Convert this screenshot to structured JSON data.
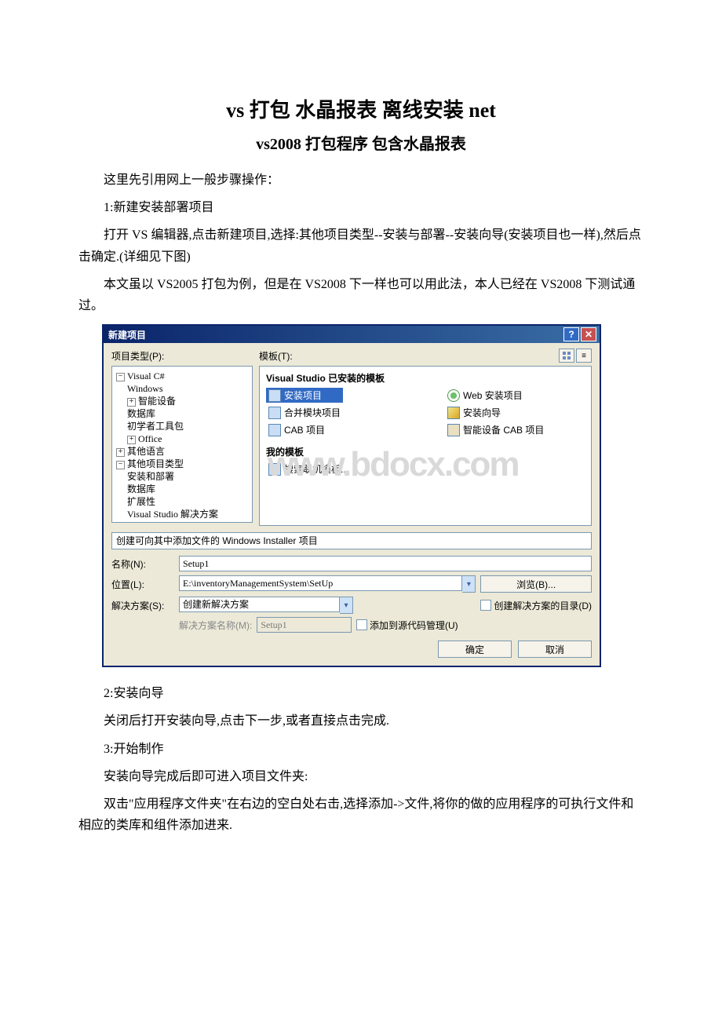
{
  "title": "vs 打包 水晶报表 离线安装 net",
  "subtitle": "vs2008 打包程序 包含水晶报表",
  "paragraphs": {
    "p1": "这里先引用网上一般步骤操作：",
    "p2": "1:新建安装部署项目",
    "p3": "打开 VS 编辑器,点击新建项目,选择:其他项目类型--安装与部署--安装向导(安装项目也一样),然后点击确定.(详细见下图)",
    "p4": "本文虽以 VS2005 打包为例，但是在 VS2008 下一样也可以用此法，本人已经在 VS2008 下测试通过。",
    "p5": "2:安装向导",
    "p6": "关闭后打开安装向导,点击下一步,或者直接点击完成.",
    "p7": "3:开始制作",
    "p8": "安装向导完成后即可进入项目文件夹:",
    "p9": "双击\"应用程序文件夹\"在右边的空白处右击,选择添加->文件,将你的做的应用程序的可执行文件和相应的类库和组件添加进来."
  },
  "dialog": {
    "title": "新建项目",
    "help": "?",
    "close": "✕",
    "proj_types_label": "项目类型(P):",
    "templates_label": "模板(T):",
    "tree": {
      "n0": "Visual C#",
      "n0_0": "Windows",
      "n0_1": "智能设备",
      "n0_2": "数据库",
      "n0_3": "初学者工具包",
      "n0_4": "Office",
      "n1": "其他语言",
      "n2": "其他项目类型",
      "n2_0": "安装和部署",
      "n2_1": "数据库",
      "n2_2": "扩展性",
      "n2_3": "Visual Studio 解决方案"
    },
    "section_installed": "Visual Studio 已安装的模板",
    "section_my": "我的模板",
    "tpls": {
      "setup": "安装项目",
      "merge": "合并模块项目",
      "cab": "CAB 项目",
      "web": "Web 安装项目",
      "wizard": "安装向导",
      "smartcab": "智能设备 CAB 项目",
      "search_online": "搜索联机模板..."
    },
    "watermark": "www.bdocx.com",
    "desc": "创建可向其中添加文件的 Windows Installer 项目",
    "name_label": "名称(N):",
    "name_value": "Setup1",
    "location_label": "位置(L):",
    "location_value": "E:\\inventoryManagementSystem\\SetUp",
    "browse": "浏览(B)...",
    "solution_label": "解决方案(S):",
    "solution_value": "创建新解决方案",
    "create_dir": "创建解决方案的目录(D)",
    "sln_name_label": "解决方案名称(M):",
    "sln_name_value": "Setup1",
    "add_scm": "添加到源代码管理(U)",
    "ok": "确定",
    "cancel": "取消"
  }
}
